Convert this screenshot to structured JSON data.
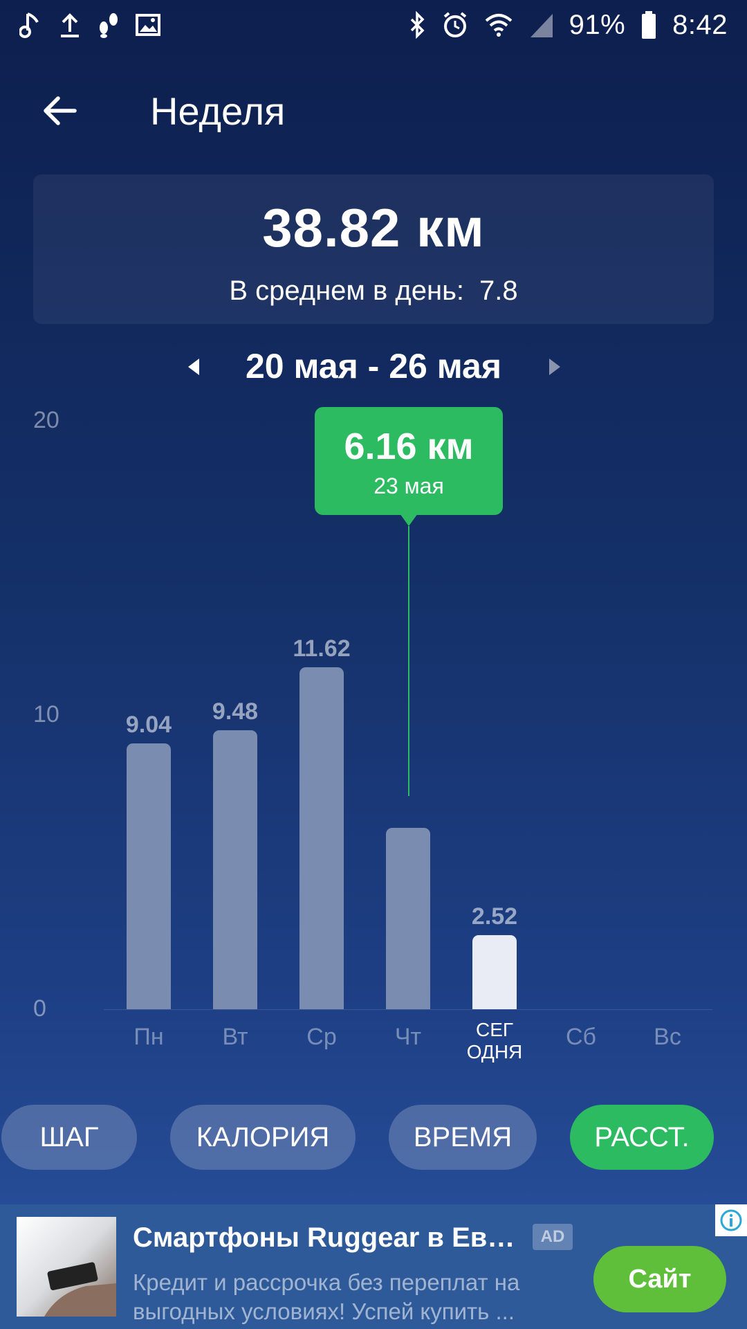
{
  "status_bar": {
    "battery": "91%",
    "time": "8:42",
    "left_icons": [
      "music-note-icon",
      "upload-icon",
      "footsteps-icon",
      "image-icon"
    ],
    "right_icons": [
      "bluetooth-icon",
      "alarm-icon",
      "wifi-icon",
      "signal-icon",
      "battery-icon"
    ]
  },
  "header": {
    "title": "Неделя"
  },
  "summary": {
    "total": "38.82 км",
    "average_label": "В среднем в день:",
    "average_value": "7.8"
  },
  "week": {
    "range": "20 мая - 26 мая"
  },
  "tooltip": {
    "value": "6.16 км",
    "date": "23 мая"
  },
  "chart_data": {
    "type": "bar",
    "categories": [
      "Пн",
      "Вт",
      "Ср",
      "Чт",
      "СЕГ ОДНЯ",
      "Сб",
      "Вс"
    ],
    "values": [
      9.04,
      9.48,
      11.62,
      6.16,
      2.52,
      0,
      0
    ],
    "value_labels": [
      "9.04",
      "9.48",
      "11.62",
      "",
      "2.52",
      "",
      ""
    ],
    "today_index": 4,
    "selected_index": 3,
    "ylim": [
      0,
      20
    ],
    "yticks": [
      "0",
      "10",
      "20"
    ],
    "colors": {
      "bar": "#7a8caf",
      "today_bar": "#e9ecf4",
      "highlight": "#2dbb62"
    }
  },
  "tabs": [
    {
      "label": "ШАГ",
      "active": false
    },
    {
      "label": "КАЛОРИЯ",
      "active": false
    },
    {
      "label": "ВРЕМЯ",
      "active": false
    },
    {
      "label": "РАССТ.",
      "active": true
    }
  ],
  "ad": {
    "title": "Смартфоны Ruggear в Евр...",
    "badge": "AD",
    "description": "Кредит и рассрочка без переплат на выгодных условиях! Успей купить ...",
    "cta": "Сайт"
  },
  "colors": {
    "accent": "#2dbb62",
    "ad_cta": "#5fbe3a",
    "background_top": "#0d1f4e",
    "background_bottom": "#2a54a0"
  }
}
